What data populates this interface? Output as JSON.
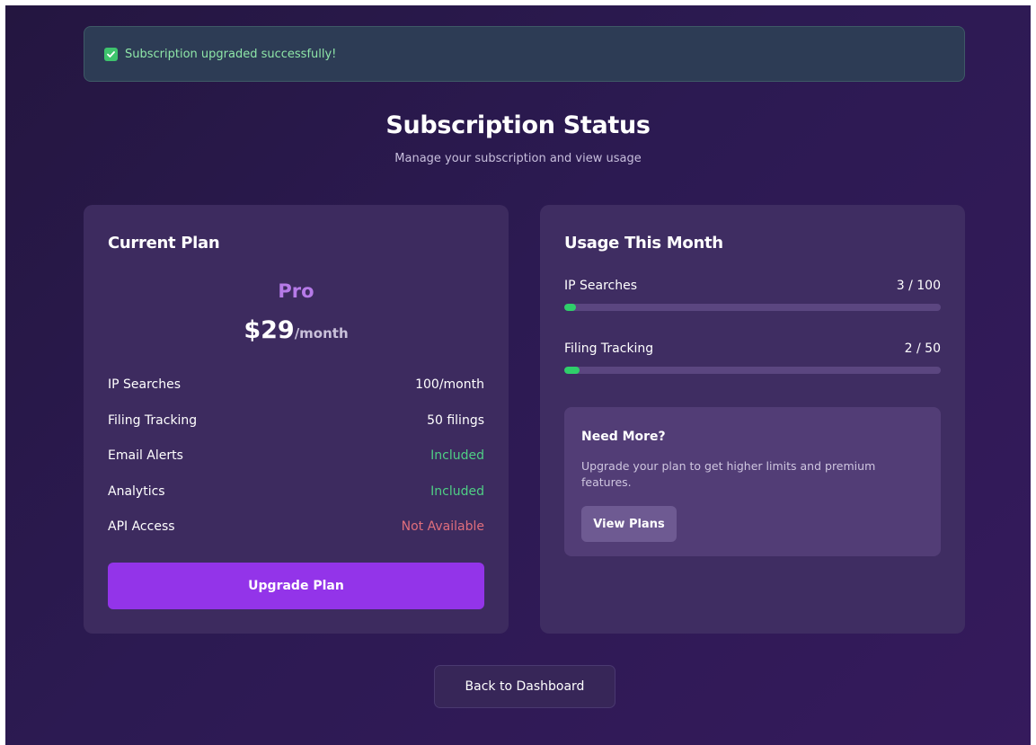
{
  "alert": {
    "icon": "check-icon",
    "message": "Subscription upgraded successfully!"
  },
  "header": {
    "title": "Subscription Status",
    "subtitle": "Manage your subscription and view usage"
  },
  "current_plan": {
    "title": "Current Plan",
    "plan_name": "Pro",
    "price": "$29",
    "period": "/month",
    "features": [
      {
        "label": "IP Searches",
        "value": "100/month",
        "status": "normal"
      },
      {
        "label": "Filing Tracking",
        "value": "50 filings",
        "status": "normal"
      },
      {
        "label": "Email Alerts",
        "value": "Included",
        "status": "included"
      },
      {
        "label": "Analytics",
        "value": "Included",
        "status": "included"
      },
      {
        "label": "API Access",
        "value": "Not Available",
        "status": "unavailable"
      }
    ],
    "upgrade_label": "Upgrade Plan"
  },
  "usage": {
    "title": "Usage This Month",
    "items": [
      {
        "label": "IP Searches",
        "display": "3 / 100",
        "used": 3,
        "limit": 100
      },
      {
        "label": "Filing Tracking",
        "display": "2 / 50",
        "used": 2,
        "limit": 50
      }
    ],
    "need_more": {
      "title": "Need More?",
      "text": "Upgrade your plan to get higher limits and premium features.",
      "button_label": "View Plans"
    }
  },
  "back_label": "Back to Dashboard",
  "colors": {
    "accent": "#9334e9",
    "plan_name": "#b67ae8",
    "success": "#4fcf85",
    "error": "#e06e7c",
    "progress": "#2fcf6a"
  }
}
